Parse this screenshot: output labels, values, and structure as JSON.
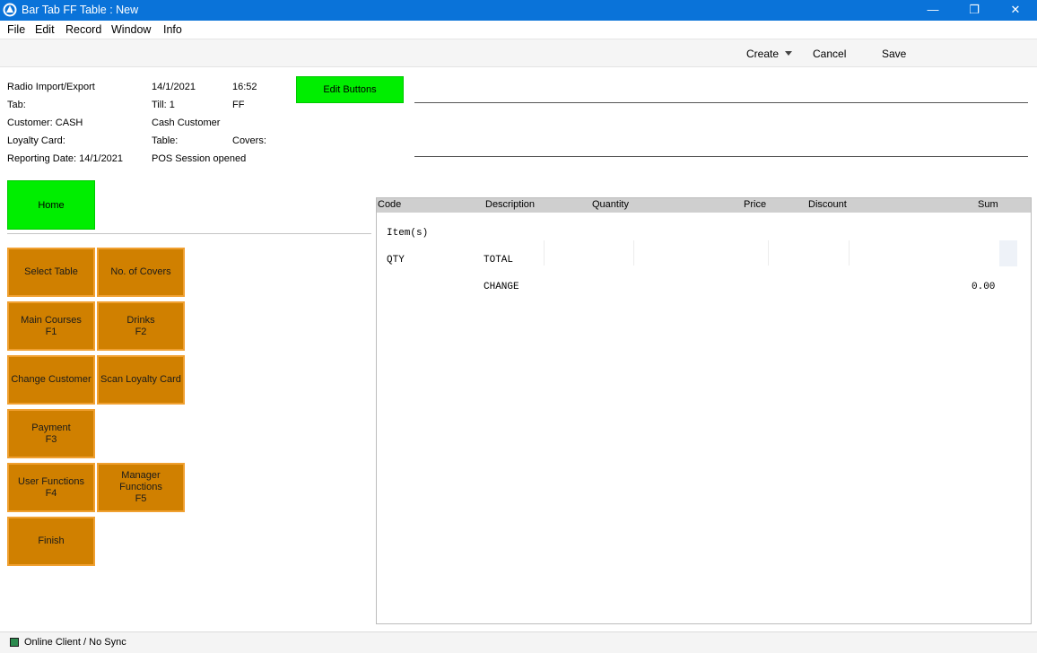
{
  "window": {
    "title": "Bar Tab FF Table : New",
    "minimize_glyph": "—",
    "maximize_glyph": "❐",
    "close_glyph": "✕"
  },
  "menu": {
    "items": [
      "File",
      "Edit",
      "Record",
      "Window",
      "Info"
    ]
  },
  "toolbar": {
    "create_label": "Create",
    "cancel_label": "Cancel",
    "save_label": "Save"
  },
  "header_info": {
    "radio": "Radio Import/Export",
    "date": "14/1/2021",
    "time": "16:52",
    "tab": "Tab:",
    "till": "Till: 1",
    "ff": "FF",
    "customer": "Customer: CASH",
    "customer_name": "Cash Customer",
    "loyalty": "Loyalty Card:",
    "table": "Table:",
    "covers": "Covers:",
    "reporting": "Reporting Date: 14/1/2021",
    "session": "POS Session opened"
  },
  "buttons": {
    "edit_buttons": "Edit Buttons",
    "home": "Home",
    "select_table": "Select Table",
    "no_covers": "No. of  Covers",
    "main_courses": "Main Courses\nF1",
    "drinks": "Drinks\nF2",
    "change_customer": "Change Customer",
    "scan_loyalty": "Scan Loyalty Card",
    "payment": "Payment\nF3",
    "user_functions": "User Functions\nF4",
    "manager_functions": "Manager\nFunctions\nF5",
    "finish": "Finish"
  },
  "grid": {
    "columns": [
      "Code",
      "Description",
      "Quantity",
      "Price",
      "Discount",
      "Sum"
    ],
    "items_label": "Item(s)",
    "qty_label": "QTY",
    "total_label": "TOTAL",
    "change_label": "CHANGE",
    "change_value": "0.00"
  },
  "status": {
    "text": "Online Client / No Sync",
    "indicator_color": "#2c8a4e"
  },
  "colors": {
    "titlebar": "#0a73d9",
    "green_button": "#00ee00",
    "function_button": "#d08000"
  }
}
